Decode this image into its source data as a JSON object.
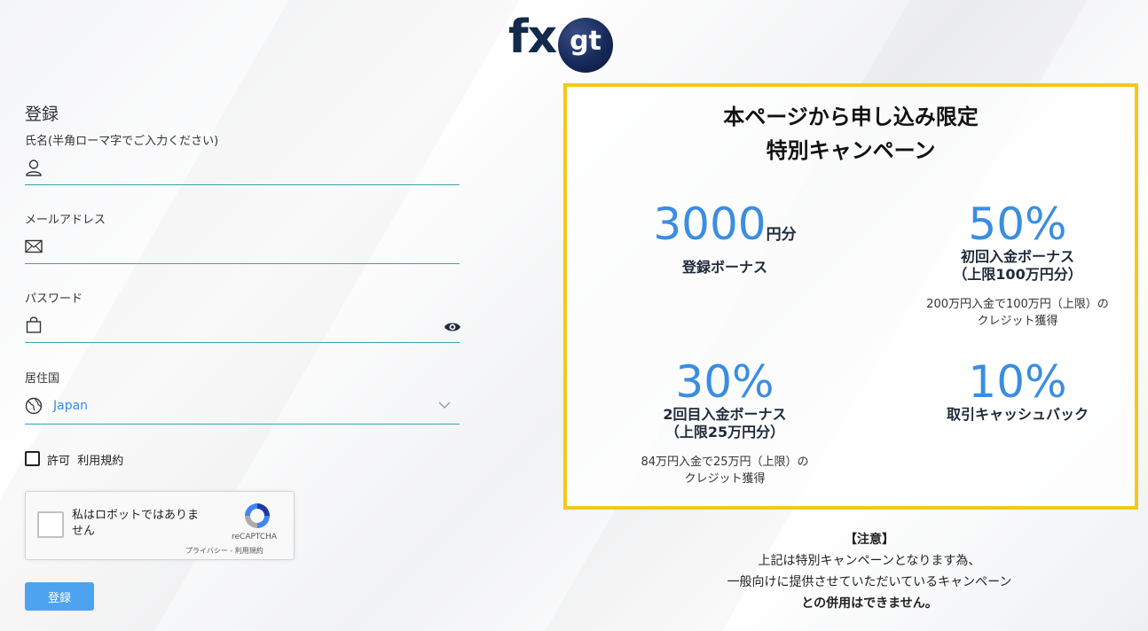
{
  "logo": {
    "fx": "fx",
    "gt": "gt"
  },
  "form": {
    "title": "登録",
    "name_label": "氏名(半角ローマ字でご入力ください)",
    "email_label": "メールアドレス",
    "password_label": "パスワード",
    "country_label": "居住国",
    "country_value": "Japan",
    "agree_prefix": "許可",
    "agree_link": "利用規約",
    "submit_label": "登録"
  },
  "captcha": {
    "text": "私はロボットではありません",
    "brand": "reCAPTCHA",
    "links": "プライバシー - 利用規約"
  },
  "promo": {
    "title_line1": "本ページから申し込み限定",
    "title_line2": "特別キャンペーン",
    "items": [
      {
        "value": "3000",
        "unit": "円分",
        "label": "登録ボーナス",
        "label2": "",
        "note1": "",
        "note2": ""
      },
      {
        "value": "50%",
        "unit": "",
        "label": "初回入金ボーナス",
        "label2": "（上限100万円分）",
        "note1": "200万円入金で100万円（上限）の",
        "note2": "クレジット獲得"
      },
      {
        "value": "30%",
        "unit": "",
        "label": "2回目入金ボーナス",
        "label2": "（上限25万円分）",
        "note1": "84万円入金で25万円（上限）の",
        "note2": "クレジット獲得"
      },
      {
        "value": "10%",
        "unit": "",
        "label": "取引キャッシュバック",
        "label2": "",
        "note1": "",
        "note2": ""
      }
    ]
  },
  "notice": {
    "heading": "【注意】",
    "line1": "上記は特別キャンペーンとなります為、",
    "line2": "一般向けに提供させていただいているキャンペーン",
    "line3": "との併用はできません。"
  },
  "colors": {
    "accent": "#3b8de0",
    "border": "#f4c81a",
    "button": "#4da3f0",
    "line": "#3aa3b0"
  }
}
